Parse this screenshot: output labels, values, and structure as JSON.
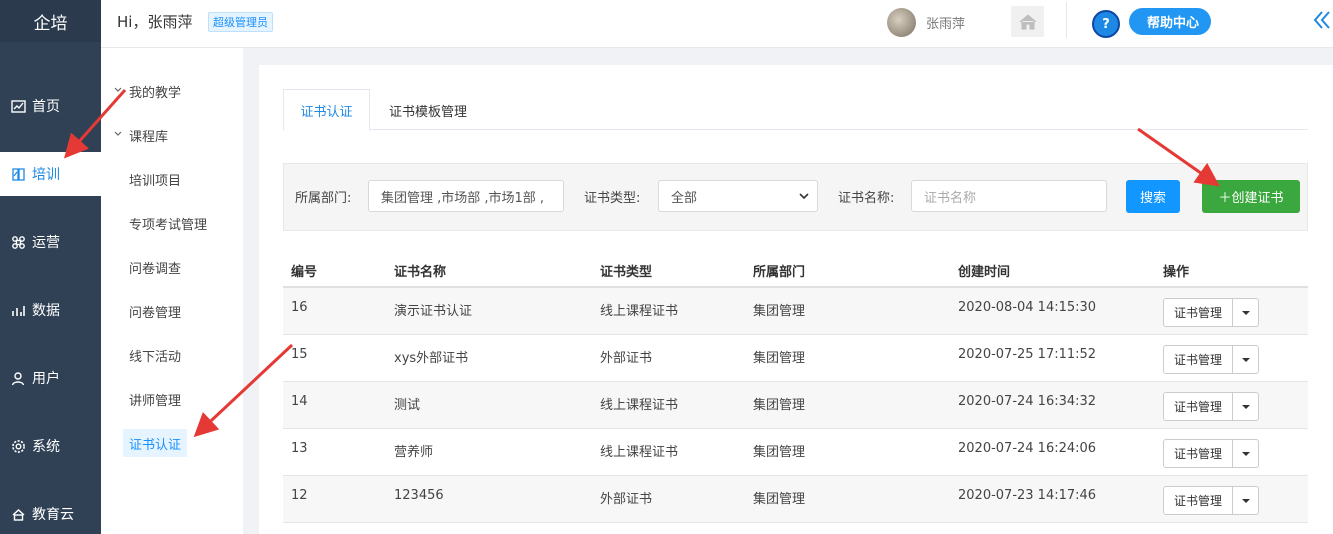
{
  "brand": "企培",
  "nav": {
    "items": [
      {
        "label": "首页",
        "icon": "chart-icon"
      },
      {
        "label": "培训",
        "icon": "book-icon"
      },
      {
        "label": "运营",
        "icon": "command-icon"
      },
      {
        "label": "数据",
        "icon": "bars-icon"
      },
      {
        "label": "用户",
        "icon": "user-icon"
      },
      {
        "label": "系统",
        "icon": "gear-icon"
      },
      {
        "label": "教育云",
        "icon": "cloud-icon"
      }
    ],
    "active_index": 1
  },
  "header": {
    "greeting": "Hi，张雨萍",
    "role": "超级管理员",
    "user_name": "张雨萍",
    "help_label": "帮助中心",
    "help_q": "?"
  },
  "subnav": {
    "groups": [
      "我的教学",
      "课程库"
    ],
    "items": [
      "培训项目",
      "专项考试管理",
      "问卷调查",
      "问卷管理",
      "线下活动",
      "讲师管理"
    ],
    "selected": "证书认证"
  },
  "tabs": [
    "证书认证",
    "证书模板管理"
  ],
  "filter": {
    "dept_label": "所属部门:",
    "dept_value": "集团管理 ,市场部 ,市场1部 ,",
    "type_label": "证书类型:",
    "type_value": "全部",
    "name_label": "证书名称:",
    "name_placeholder": "证书名称",
    "search_label": "搜索",
    "create_label": "＋创建证书"
  },
  "table": {
    "headers": [
      "编号",
      "证书名称",
      "证书类型",
      "所属部门",
      "创建时间",
      "操作"
    ],
    "action_label": "证书管理",
    "rows": [
      [
        "16",
        "演示证书认证",
        "线上课程证书",
        "集团管理",
        "2020-08-04 14:15:30"
      ],
      [
        "15",
        "xys外部证书",
        "外部证书",
        "集团管理",
        "2020-07-25 17:11:52"
      ],
      [
        "14",
        "测试",
        "线上课程证书",
        "集团管理",
        "2020-07-24 16:34:32"
      ],
      [
        "13",
        "营养师",
        "线上课程证书",
        "集团管理",
        "2020-07-24 16:24:06"
      ],
      [
        "12",
        "123456",
        "外部证书",
        "集团管理",
        "2020-07-23 14:17:46"
      ]
    ]
  },
  "colors": {
    "nav_bg": "#304156",
    "accent": "#1e88e5",
    "search_btn": "#1296ff",
    "create_btn": "#3aa83e",
    "annotation_arrow": "#e53935"
  }
}
